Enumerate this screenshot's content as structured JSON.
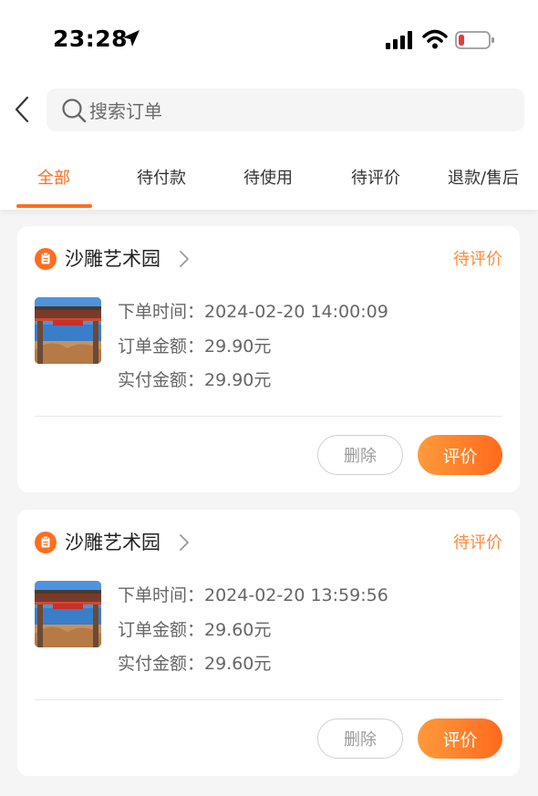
{
  "status_bar": {
    "time": "23:28",
    "icons": [
      "location-arrow-icon",
      "cellular-signal-icon",
      "wifi-icon",
      "battery-low-icon"
    ],
    "battery_color": "#e63b3b"
  },
  "search": {
    "placeholder": "搜索订单"
  },
  "tabs": [
    {
      "label": "全部",
      "active": true
    },
    {
      "label": "待付款",
      "active": false
    },
    {
      "label": "待使用",
      "active": false
    },
    {
      "label": "待评价",
      "active": false
    },
    {
      "label": "退款/售后",
      "active": false
    }
  ],
  "colors": {
    "accent": "#ff6d1f",
    "status_text": "#ff8a3d",
    "background": "#f5f5f5"
  },
  "orders": [
    {
      "shop_name": "沙雕艺术园",
      "status": "待评价",
      "order_time": "下单时间：2024-02-20 14:00:09",
      "order_amount": "订单金额：29.90元",
      "paid_amount": "实付金额：29.90元",
      "delete_label": "删除",
      "review_label": "评价"
    },
    {
      "shop_name": "沙雕艺术园",
      "status": "待评价",
      "order_time": "下单时间：2024-02-20 13:59:56",
      "order_amount": "订单金额：29.60元",
      "paid_amount": "实付金额：29.60元",
      "delete_label": "删除",
      "review_label": "评价"
    }
  ]
}
